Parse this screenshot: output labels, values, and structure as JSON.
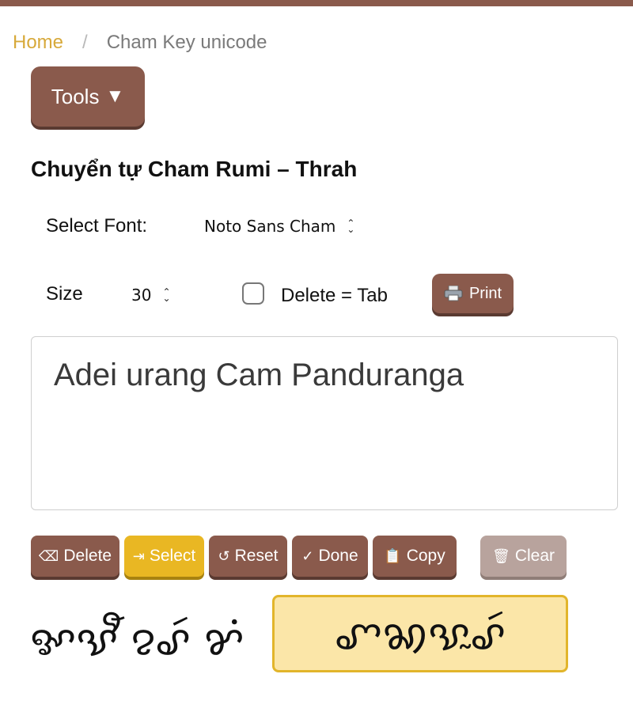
{
  "breadcrumb": {
    "home": "Home",
    "separator": "/",
    "current": "Cham Key unicode"
  },
  "tools": {
    "label": "Tools",
    "arrow": "▼"
  },
  "page": {
    "title": "Chuyển tự Cham Rumi – Thrah"
  },
  "font_select": {
    "label": "Select Font:",
    "value": "Noto Sans Cham"
  },
  "size_select": {
    "label": "Size",
    "value": "30"
  },
  "delete_tab": {
    "label": "Delete = Tab",
    "checked": false
  },
  "print": {
    "label": "Print",
    "icon": "printer-icon"
  },
  "editor": {
    "text": "Adei urang Cam Panduranga"
  },
  "actions": [
    {
      "label": "Delete",
      "icon": "⌫"
    },
    {
      "label": "Select",
      "icon": "⇥"
    },
    {
      "label": "Reset",
      "icon": "↺"
    },
    {
      "label": "Done",
      "icon": "✓"
    },
    {
      "label": "Copy",
      "icon": "📋"
    },
    {
      "label": "Clear",
      "icon": "🗑"
    }
  ],
  "output": {
    "words": "ꨀꨕꨬ ꨂꨣꩃ ꨌꩌ",
    "selected_word": "ꨚꩆꨕꨭꨣꩃ"
  },
  "colors": {
    "brand": "#8a5a4c",
    "accent": "#e9b723",
    "highlight_bg": "#fbe6a8"
  }
}
